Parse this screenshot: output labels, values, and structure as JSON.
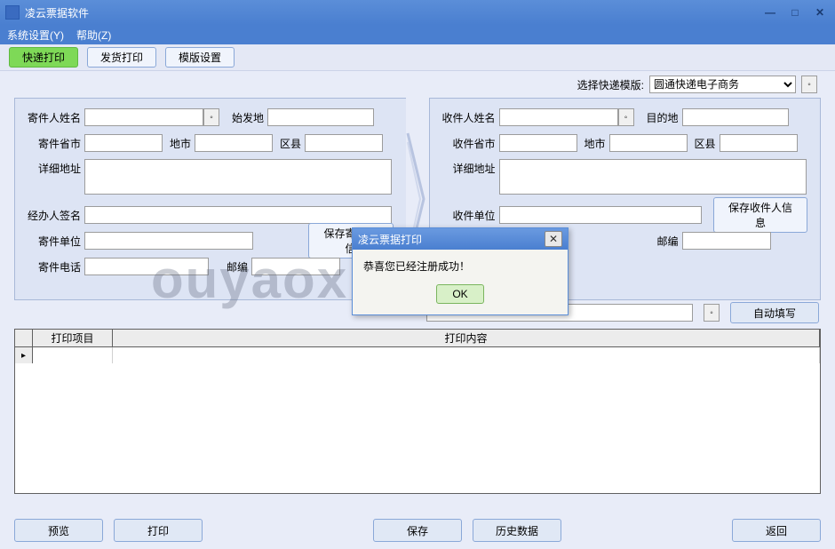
{
  "window": {
    "title": "凌云票据软件",
    "min": "—",
    "max": "□",
    "close": "✕"
  },
  "menu": {
    "settings": "系统设置(Y)",
    "help": "帮助(Z)"
  },
  "toolbar": {
    "express_print": "快递打印",
    "shipment_print": "发货打印",
    "template_config": "模版设置"
  },
  "template_selector": {
    "label": "选择快递模版:",
    "value": "圆通快递电子商务"
  },
  "sender": {
    "name_label": "寄件人姓名",
    "origin_label": "始发地",
    "province_label": "寄件省市",
    "city_label": "地市",
    "district_label": "区县",
    "address_label": "详细地址",
    "signer_label": "经办人签名",
    "unit_label": "寄件单位",
    "phone_label": "寄件电话",
    "postcode_label": "邮编",
    "save_btn": "保存寄件人信"
  },
  "receiver": {
    "name_label": "收件人姓名",
    "dest_label": "目的地",
    "province_label": "收件省市",
    "city_label": "地市",
    "district_label": "区县",
    "address_label": "详细地址",
    "unit_label": "收件单位",
    "postcode_label": "邮编",
    "save_btn": "保存收件人信息"
  },
  "autofill": "自动填写",
  "grid": {
    "col_item": "打印项目",
    "col_content": "打印内容"
  },
  "footer": {
    "preview": "预览",
    "print": "打印",
    "save": "保存",
    "history": "历史数据",
    "back": "返回"
  },
  "dialog": {
    "title": "凌云票据打印",
    "message": "恭喜您已经注册成功！",
    "ok": "OK"
  },
  "watermark": "ouyaoxiazai"
}
